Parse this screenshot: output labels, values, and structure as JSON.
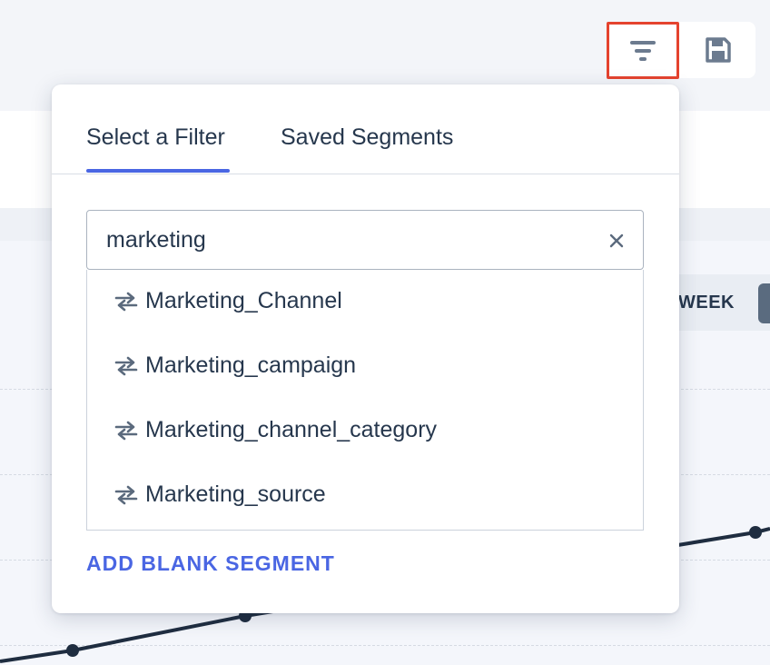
{
  "toolbar": {
    "filter_icon": "filter-lines-icon",
    "save_icon": "floppy-disk-icon",
    "highlight_color": "#e5432e"
  },
  "background": {
    "week_label": "WEEK",
    "line_color": "#1f2d40"
  },
  "popover": {
    "tabs": [
      {
        "label": "Select a Filter",
        "active": true
      },
      {
        "label": "Saved Segments",
        "active": false
      }
    ],
    "search": {
      "value": "marketing",
      "clear_icon": "close-icon"
    },
    "results": [
      {
        "label": "Marketing_Channel",
        "icon": "swap-arrows-icon"
      },
      {
        "label": "Marketing_campaign",
        "icon": "swap-arrows-icon"
      },
      {
        "label": "Marketing_channel_category",
        "icon": "swap-arrows-icon"
      },
      {
        "label": "Marketing_source",
        "icon": "swap-arrows-icon"
      }
    ],
    "add_blank_label": "ADD BLANK SEGMENT",
    "accent_color": "#4a66e3"
  }
}
